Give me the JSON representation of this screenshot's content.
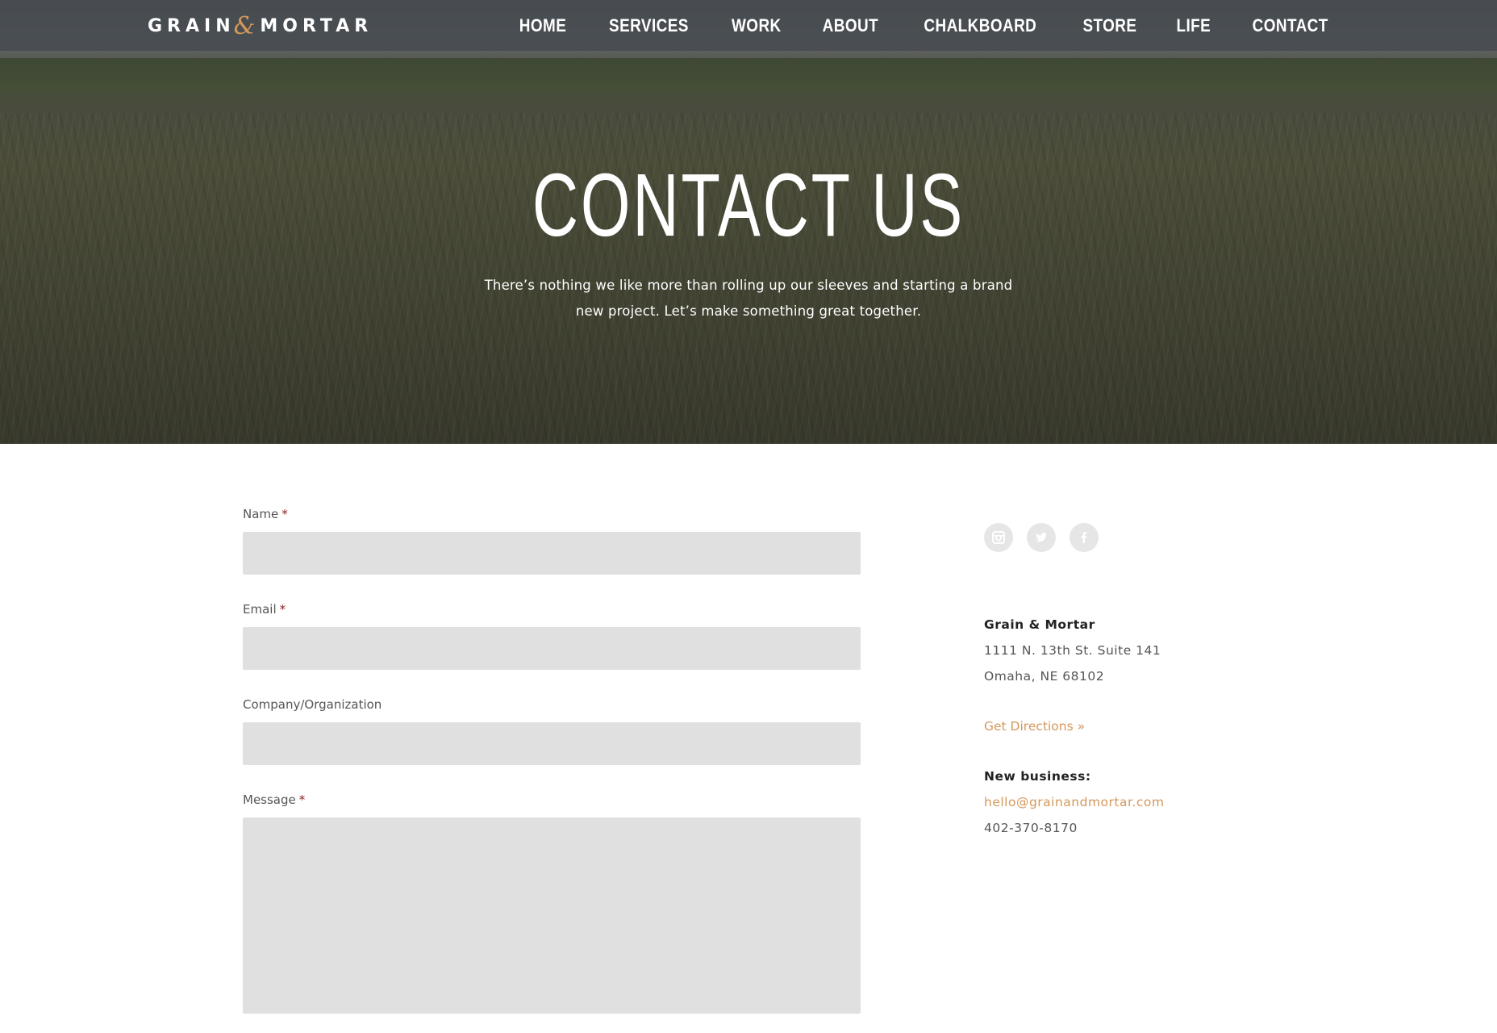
{
  "brand": {
    "logo_left": "GRAIN",
    "logo_amp": "&",
    "logo_right": "MORTAR",
    "accent_color": "#d4975a"
  },
  "nav": {
    "items": [
      {
        "label": "HOME"
      },
      {
        "label": "SERVICES"
      },
      {
        "label": "WORK"
      },
      {
        "label": "ABOUT"
      },
      {
        "label": "CHALKBOARD"
      },
      {
        "label": "STORE"
      },
      {
        "label": "LIFE"
      },
      {
        "label": "CONTACT"
      }
    ]
  },
  "hero": {
    "title": "CONTACT US",
    "subtitle_line1": "There’s nothing we like more than rolling up our sleeves and starting a brand",
    "subtitle_line2": "new project. Let’s make something great together."
  },
  "form": {
    "name_label": "Name",
    "email_label": "Email",
    "company_label": "Company/Organization",
    "message_label": "Message",
    "required_mark": "*"
  },
  "contact": {
    "socials": [
      {
        "icon": "instagram-icon"
      },
      {
        "icon": "twitter-icon"
      },
      {
        "icon": "facebook-icon"
      }
    ],
    "business_name": "Grain & Mortar",
    "address_line1": "1111 N. 13th St. Suite 141",
    "address_line2": "Omaha, NE 68102",
    "directions_link": "Get Directions »",
    "new_business_label": "New business:",
    "email": "hello@grainandmortar.com",
    "phone": "402-370-8170"
  }
}
